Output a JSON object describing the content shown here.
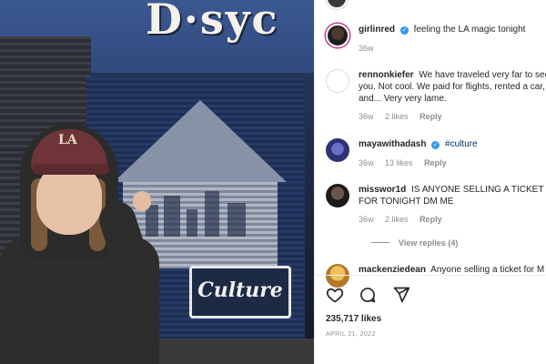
{
  "photo": {
    "sign_text": "D·syc",
    "cap_logo": "LA",
    "mural_text": "Culture"
  },
  "post": {
    "author_avatar_color": "#2a2a2a",
    "caption": {
      "username": "girlinred",
      "text": "feeling the LA magic tonight",
      "age": "36w"
    },
    "comments": [
      {
        "username": "rennonkiefer",
        "text": "We have traveled very far to see you. Not cool. We paid for flights, rented a car, and... Very very lame.",
        "age": "36w",
        "likes": "2 likes",
        "reply": "Reply",
        "avatar_color": "#ffffff"
      },
      {
        "username": "mayawithadash",
        "verified": true,
        "tag": "#culture",
        "age": "36w",
        "likes": "13 likes",
        "reply": "Reply",
        "avatar_color": "#3b3f86"
      },
      {
        "username": "misswor1d",
        "text": "IS ANYONE SELLING A TICKET FOR TONIGHT DM ME",
        "age": "36w",
        "likes": "2 likes",
        "reply": "Reply",
        "view_replies": "View replies (4)",
        "avatar_color": "#2b2421"
      },
      {
        "username": "mackenziedean",
        "text": "Anyone selling a ticket for M",
        "avatar_color": "#d9a441"
      }
    ],
    "likes": "235,717 likes",
    "date": "APRIL 21, 2022"
  },
  "icons": {
    "like": "heart-icon",
    "comment": "comment-icon",
    "share": "share-icon"
  },
  "colors": {
    "verified": "#3897f0",
    "text": "#262626",
    "muted": "#8e8e8e",
    "link": "#00376b"
  }
}
